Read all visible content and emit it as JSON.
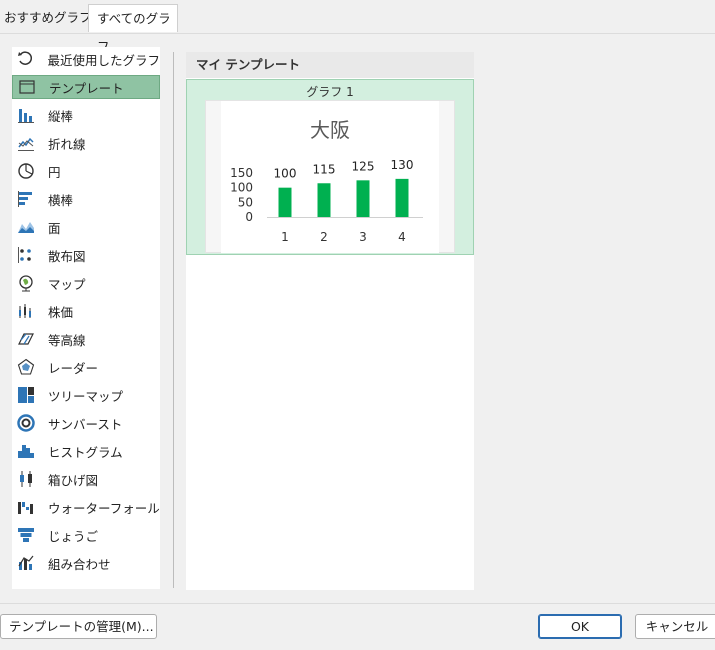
{
  "tabs": [
    "おすすめグラフ",
    "すべてのグラフ"
  ],
  "sidebar": {
    "items": [
      {
        "label": "最近使用したグラフ",
        "icon": "recent-icon",
        "selected": false
      },
      {
        "label": "テンプレート",
        "icon": "folder-icon",
        "selected": true
      },
      {
        "label": "縦棒",
        "icon": "column-chart-icon",
        "selected": false
      },
      {
        "label": "折れ線",
        "icon": "line-chart-icon",
        "selected": false
      },
      {
        "label": "円",
        "icon": "pie-chart-icon",
        "selected": false
      },
      {
        "label": "横棒",
        "icon": "bar-chart-icon",
        "selected": false
      },
      {
        "label": "面",
        "icon": "area-chart-icon",
        "selected": false
      },
      {
        "label": "散布図",
        "icon": "scatter-chart-icon",
        "selected": false
      },
      {
        "label": "マップ",
        "icon": "map-chart-icon",
        "selected": false
      },
      {
        "label": "株価",
        "icon": "stock-chart-icon",
        "selected": false
      },
      {
        "label": "等高線",
        "icon": "surface-chart-icon",
        "selected": false
      },
      {
        "label": "レーダー",
        "icon": "radar-chart-icon",
        "selected": false
      },
      {
        "label": "ツリーマップ",
        "icon": "treemap-chart-icon",
        "selected": false
      },
      {
        "label": "サンバースト",
        "icon": "sunburst-chart-icon",
        "selected": false
      },
      {
        "label": "ヒストグラム",
        "icon": "histogram-chart-icon",
        "selected": false
      },
      {
        "label": "箱ひげ図",
        "icon": "box-whisker-chart-icon",
        "selected": false
      },
      {
        "label": "ウォーターフォール",
        "icon": "waterfall-chart-icon",
        "selected": false
      },
      {
        "label": "じょうご",
        "icon": "funnel-chart-icon",
        "selected": false
      },
      {
        "label": "組み合わせ",
        "icon": "combo-chart-icon",
        "selected": false
      }
    ]
  },
  "main": {
    "section_title": "マイ テンプレート",
    "template_name": "グラフ 1"
  },
  "chart_data": {
    "type": "bar",
    "title": "大阪",
    "categories": [
      "1",
      "2",
      "3",
      "4"
    ],
    "values": [
      100,
      115,
      125,
      130
    ],
    "yticks": [
      "150",
      "100",
      "50",
      "0"
    ],
    "bar_color": "#00b050"
  },
  "footer": {
    "manage_label": "テンプレートの管理(M)...",
    "ok_label": "OK",
    "cancel_label": "キャンセル"
  },
  "colors": {
    "selected_bg": "#8fc3a3",
    "thumb_bg": "#d3efdf",
    "accent_blue": "#2b6cb0",
    "icon_blue": "#2e75b6"
  }
}
